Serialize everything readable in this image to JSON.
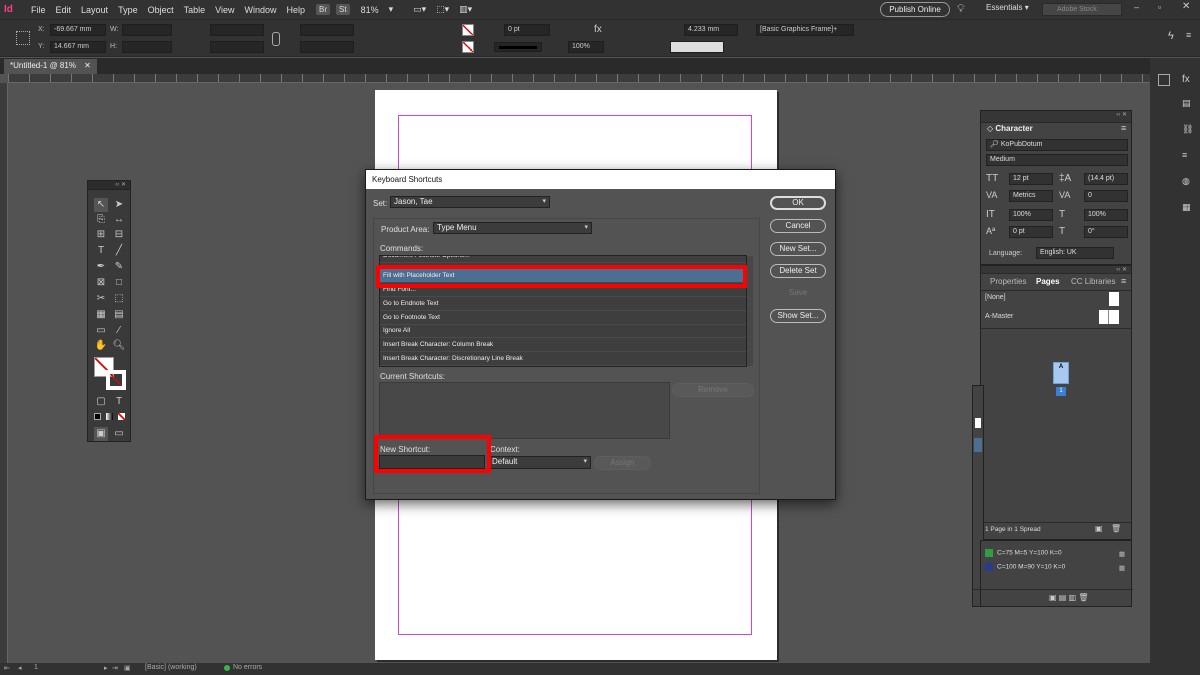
{
  "menubar": {
    "app_logo": "Id",
    "items": [
      "File",
      "Edit",
      "Layout",
      "Type",
      "Object",
      "Table",
      "View",
      "Window",
      "Help"
    ],
    "bridge": "Br",
    "stock": "St",
    "zoom": "81%",
    "publish": "Publish Online",
    "workspace": "Essentials",
    "stock_search_placeholder": "Adobe Stock"
  },
  "control": {
    "x_label": "X:",
    "x_value": "-69.667 mm",
    "y_label": "Y:",
    "y_value": "14.667 mm",
    "w_label": "W:",
    "h_label": "H:",
    "stroke_weight": "0 pt",
    "opacity": "100%",
    "dimension": "4.233 mm",
    "frame_style": "[Basic Graphics Frame]+"
  },
  "document_tab": "*Untitled-1 @ 81%",
  "status": {
    "page": "1",
    "style": "[Basic] (working)",
    "errors": "No errors"
  },
  "character_panel": {
    "title": "Character",
    "font": "KoPubDotum",
    "style": "Medium",
    "size": "12 pt",
    "leading": "(14.4 pt)",
    "kerning": "Metrics",
    "tracking": "0",
    "vscale": "100%",
    "hscale": "100%",
    "baseline": "0 pt",
    "skew": "0°",
    "language_label": "Language:",
    "language": "English: UK"
  },
  "pages_panel": {
    "tabs": [
      "Properties",
      "Pages",
      "CC Libraries"
    ],
    "none_master": "[None]",
    "a_master": "A-Master",
    "page_letter": "A",
    "page_number": "1",
    "summary": "1 Page in 1 Spread"
  },
  "swatches": [
    {
      "label": "C=75 M=5 Y=100 K=0",
      "color": "#2e9e3e"
    },
    {
      "label": "C=100 M=90 Y=10 K=0",
      "color": "#2a3b8f"
    }
  ],
  "dialog": {
    "title": "Keyboard Shortcuts",
    "set_label": "Set:",
    "set_value": "Jason, Tae",
    "product_area_label": "Product Area:",
    "product_area_value": "Type Menu",
    "commands_label": "Commands:",
    "commands": [
      "Document Footnote Options...",
      "Fill with Placeholder Text",
      "Find Font...",
      "Go to Endnote Text",
      "Go to Footnote Text",
      "Ignore All",
      "Insert Break Character: Column Break",
      "Insert Break Character: Discretionary Line Break"
    ],
    "selected_command": "Fill with Placeholder Text",
    "current_shortcuts_label": "Current Shortcuts:",
    "new_shortcut_label": "New Shortcut:",
    "context_label": "Context:",
    "context_value": "Default",
    "buttons": {
      "ok": "OK",
      "cancel": "Cancel",
      "new_set": "New Set...",
      "delete_set": "Delete Set",
      "save": "Save",
      "show_set": "Show Set...",
      "remove": "Remove",
      "assign": "Assign"
    }
  },
  "colors": {
    "highlight": "#ff0000",
    "selection": "#4b6e91",
    "margin_guide": "#d046d0"
  }
}
